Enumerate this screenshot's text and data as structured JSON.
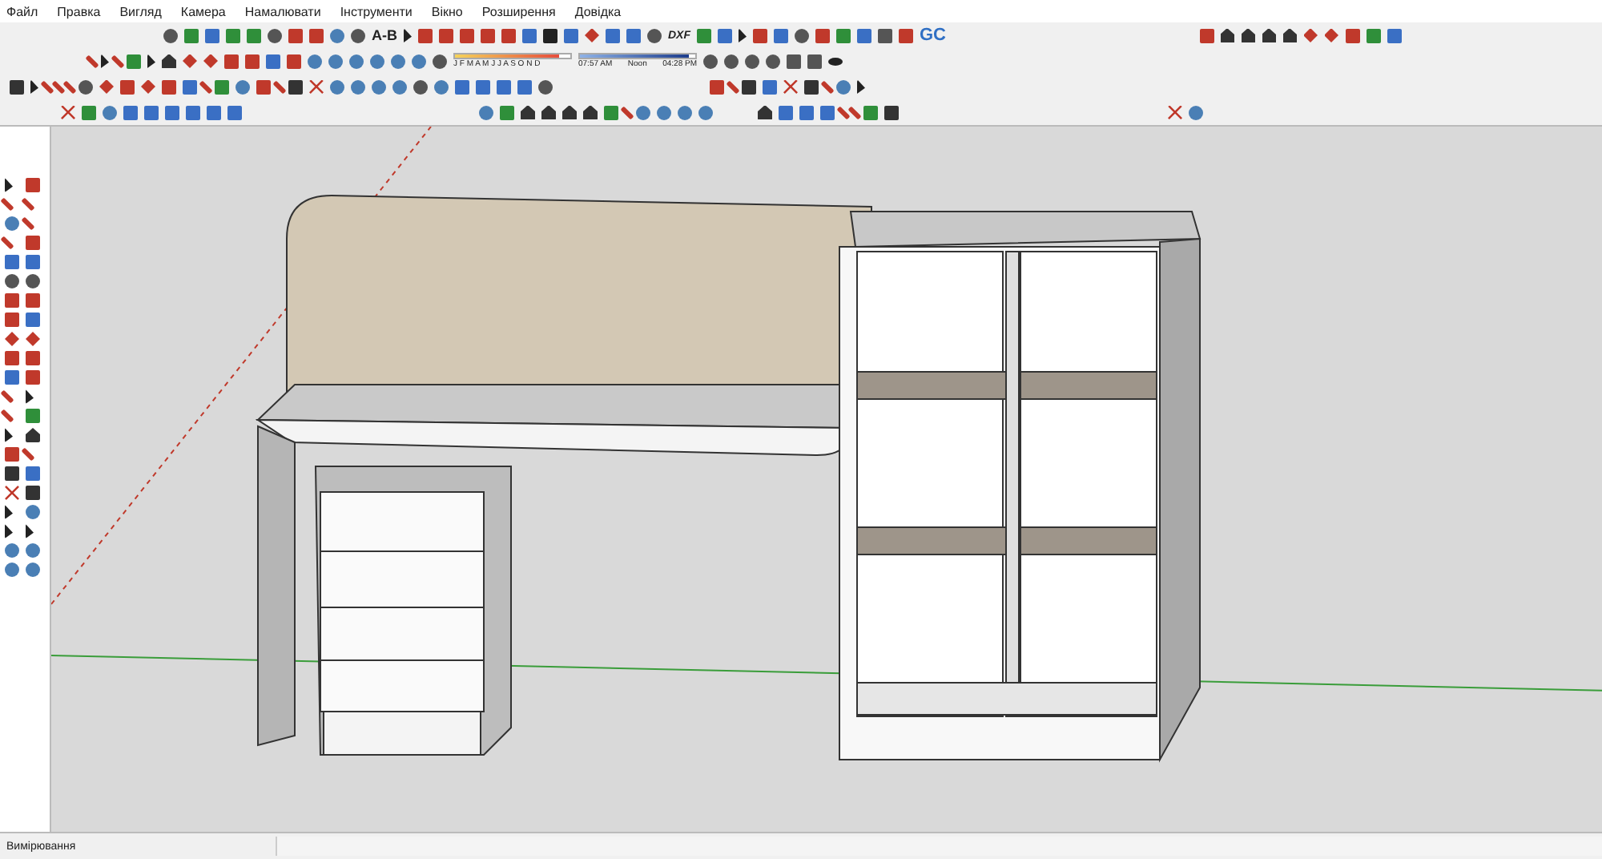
{
  "menu": [
    "Файл",
    "Правка",
    "Вигляд",
    "Камера",
    "Намалювати",
    "Інструменти",
    "Вікно",
    "Розширення",
    "Довідка"
  ],
  "toolbars": {
    "ab_label": "A-B",
    "dxf_label": "DXF",
    "months": "J F M A M J J A S O N D",
    "time_start": "07:57 AM",
    "time_noon": "Noon",
    "time_end": "04:28 PM",
    "gc_label": "GC",
    "month_slider": {
      "level": 0.9
    },
    "time_slider": {
      "level": 0.95
    }
  },
  "status_bar": {
    "text": "Вимірювання"
  }
}
